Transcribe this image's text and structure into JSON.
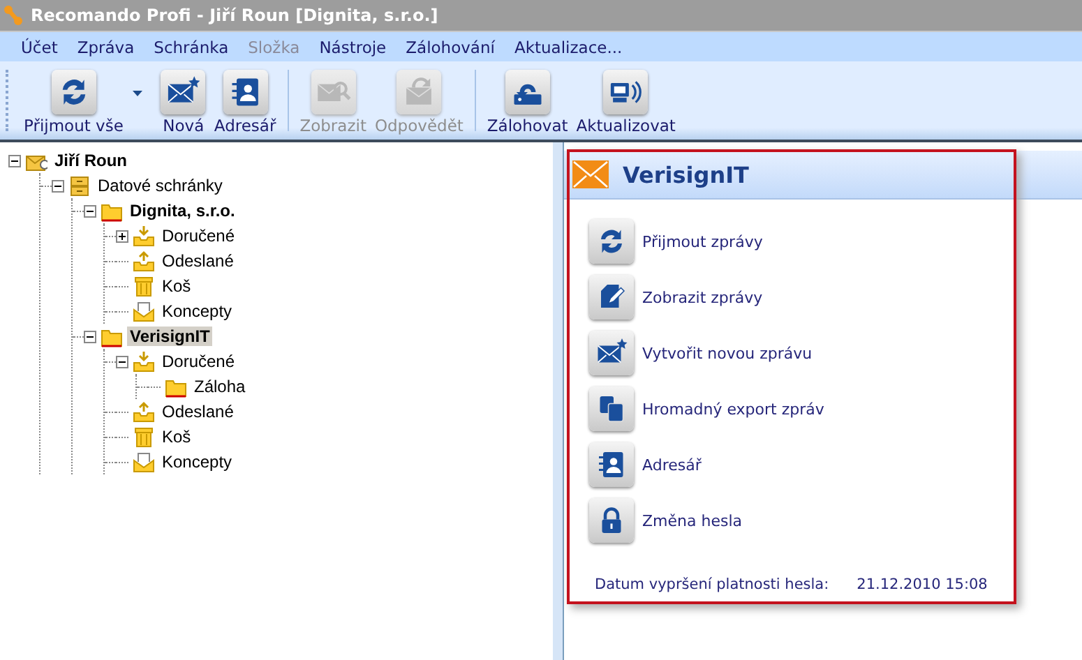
{
  "window": {
    "title": "Recomando Profi - Jiří Roun [Dignita, s.r.o.]"
  },
  "menu": [
    {
      "label": "Účet",
      "disabled": false
    },
    {
      "label": "Zpráva",
      "disabled": false
    },
    {
      "label": "Schránka",
      "disabled": false
    },
    {
      "label": "Složka",
      "disabled": true
    },
    {
      "label": "Nástroje",
      "disabled": false
    },
    {
      "label": "Zálohování",
      "disabled": false
    },
    {
      "label": "Aktualizace...",
      "disabled": false
    }
  ],
  "toolbar": [
    {
      "kind": "receive",
      "label": "Přijmout vše",
      "disabled": false,
      "dropdown": true
    },
    {
      "kind": "compose",
      "label": "Nová",
      "disabled": false,
      "dropdown": false
    },
    {
      "kind": "contacts",
      "label": "Adresář",
      "disabled": false,
      "dropdown": false
    },
    {
      "kind": "separator"
    },
    {
      "kind": "view",
      "label": "Zobrazit",
      "disabled": true,
      "dropdown": false
    },
    {
      "kind": "reply",
      "label": "Odpovědět",
      "disabled": true,
      "dropdown": false
    },
    {
      "kind": "separator"
    },
    {
      "kind": "backup",
      "label": "Zálohovat",
      "disabled": false,
      "dropdown": false
    },
    {
      "kind": "update",
      "label": "Aktualizovat",
      "disabled": false,
      "dropdown": false
    }
  ],
  "tree": [
    {
      "label": "Jiří Roun",
      "kind": "user",
      "expanded": true,
      "selected": false,
      "children": [
        {
          "label": "Datové schránky",
          "kind": "drawer",
          "expanded": true,
          "selected": false,
          "children": [
            {
              "label": "Dignita, s.r.o.",
              "kind": "account",
              "expanded": true,
              "selected": false,
              "children": [
                {
                  "label": "Doručené",
                  "kind": "inbox",
                  "expanded": false,
                  "selected": false
                },
                {
                  "label": "Odeslané",
                  "kind": "outbox",
                  "selected": false
                },
                {
                  "label": "Koš",
                  "kind": "trash",
                  "selected": false
                },
                {
                  "label": "Koncepty",
                  "kind": "drafts",
                  "selected": false
                }
              ]
            },
            {
              "label": "VerisignIT",
              "kind": "account",
              "expanded": true,
              "selected": true,
              "children": [
                {
                  "label": "Doručené",
                  "kind": "inbox",
                  "expanded": true,
                  "selected": false,
                  "children": [
                    {
                      "label": "Záloha",
                      "kind": "folder",
                      "selected": false
                    }
                  ]
                },
                {
                  "label": "Odeslané",
                  "kind": "outbox",
                  "selected": false
                },
                {
                  "label": "Koš",
                  "kind": "trash",
                  "selected": false
                },
                {
                  "label": "Koncepty",
                  "kind": "drafts",
                  "selected": false
                }
              ]
            }
          ]
        }
      ]
    }
  ],
  "panel": {
    "title": "VerisignIT",
    "actions": [
      {
        "label": "Přijmout zprávy",
        "kind": "receive"
      },
      {
        "label": "Zobrazit zprávy",
        "kind": "edit"
      },
      {
        "label": "Vytvořit novou zprávu",
        "kind": "compose"
      },
      {
        "label": "Hromadný export zpráv",
        "kind": "export"
      },
      {
        "label": "Adresář",
        "kind": "contacts"
      },
      {
        "label": "Změna hesla",
        "kind": "password"
      }
    ],
    "expiry_label": "Datum vypršení platnosti hesla:",
    "expiry_value": "21.12.2010 15:08"
  }
}
